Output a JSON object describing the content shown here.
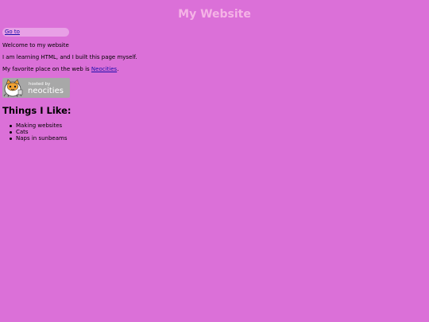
{
  "page": {
    "title": "My Website",
    "background_color": "#db70d8",
    "title_color": "#f5b3e6"
  },
  "nav": {
    "goto_label": "Go to"
  },
  "intro": {
    "welcome": "Welcome to my website",
    "learning": "I am learning HTML, and I built this page myself.",
    "favorite_prefix": "My favorite place on the web is ",
    "favorite_link": "Neocities",
    "favorite_suffix": "."
  },
  "badge": {
    "hosted_by": "hosted by",
    "brand": "neocities",
    "icon": "neocities-cat-icon"
  },
  "likes": {
    "heading": "Things I Like:",
    "items": [
      "Making websites",
      "Cats",
      "Naps in sunbeams"
    ]
  }
}
